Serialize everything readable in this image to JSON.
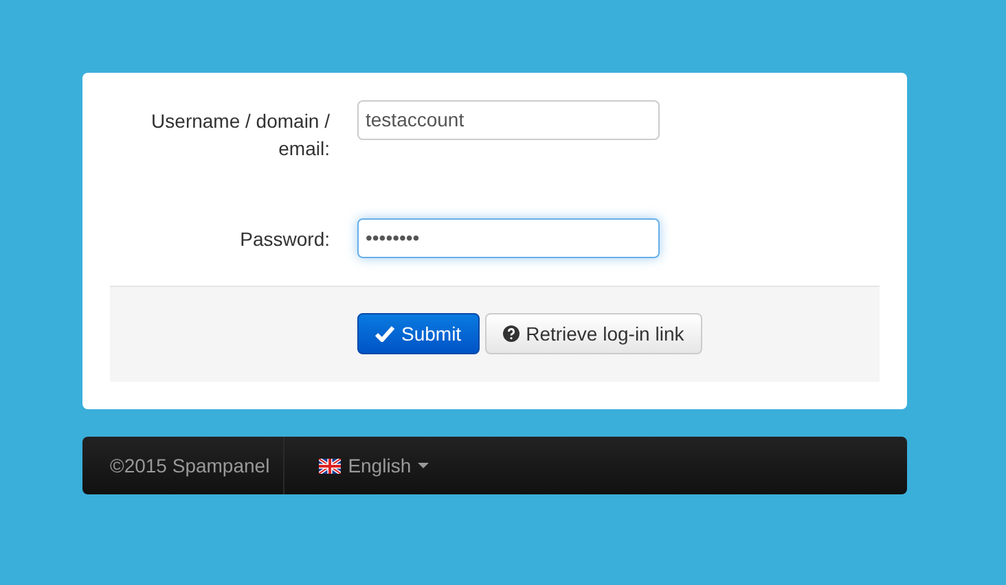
{
  "form": {
    "fields": [
      {
        "label": "Username / domain / email:",
        "value": "testaccount",
        "focused": false
      },
      {
        "label": "Password:",
        "value": "••••••••",
        "focused": true
      }
    ],
    "buttons": [
      {
        "label": "Submit",
        "kind": "primary"
      },
      {
        "label": "Retrieve log-in link",
        "kind": "default"
      }
    ]
  },
  "footer": {
    "copyright": "©2015 Spampanel",
    "language": "English"
  }
}
